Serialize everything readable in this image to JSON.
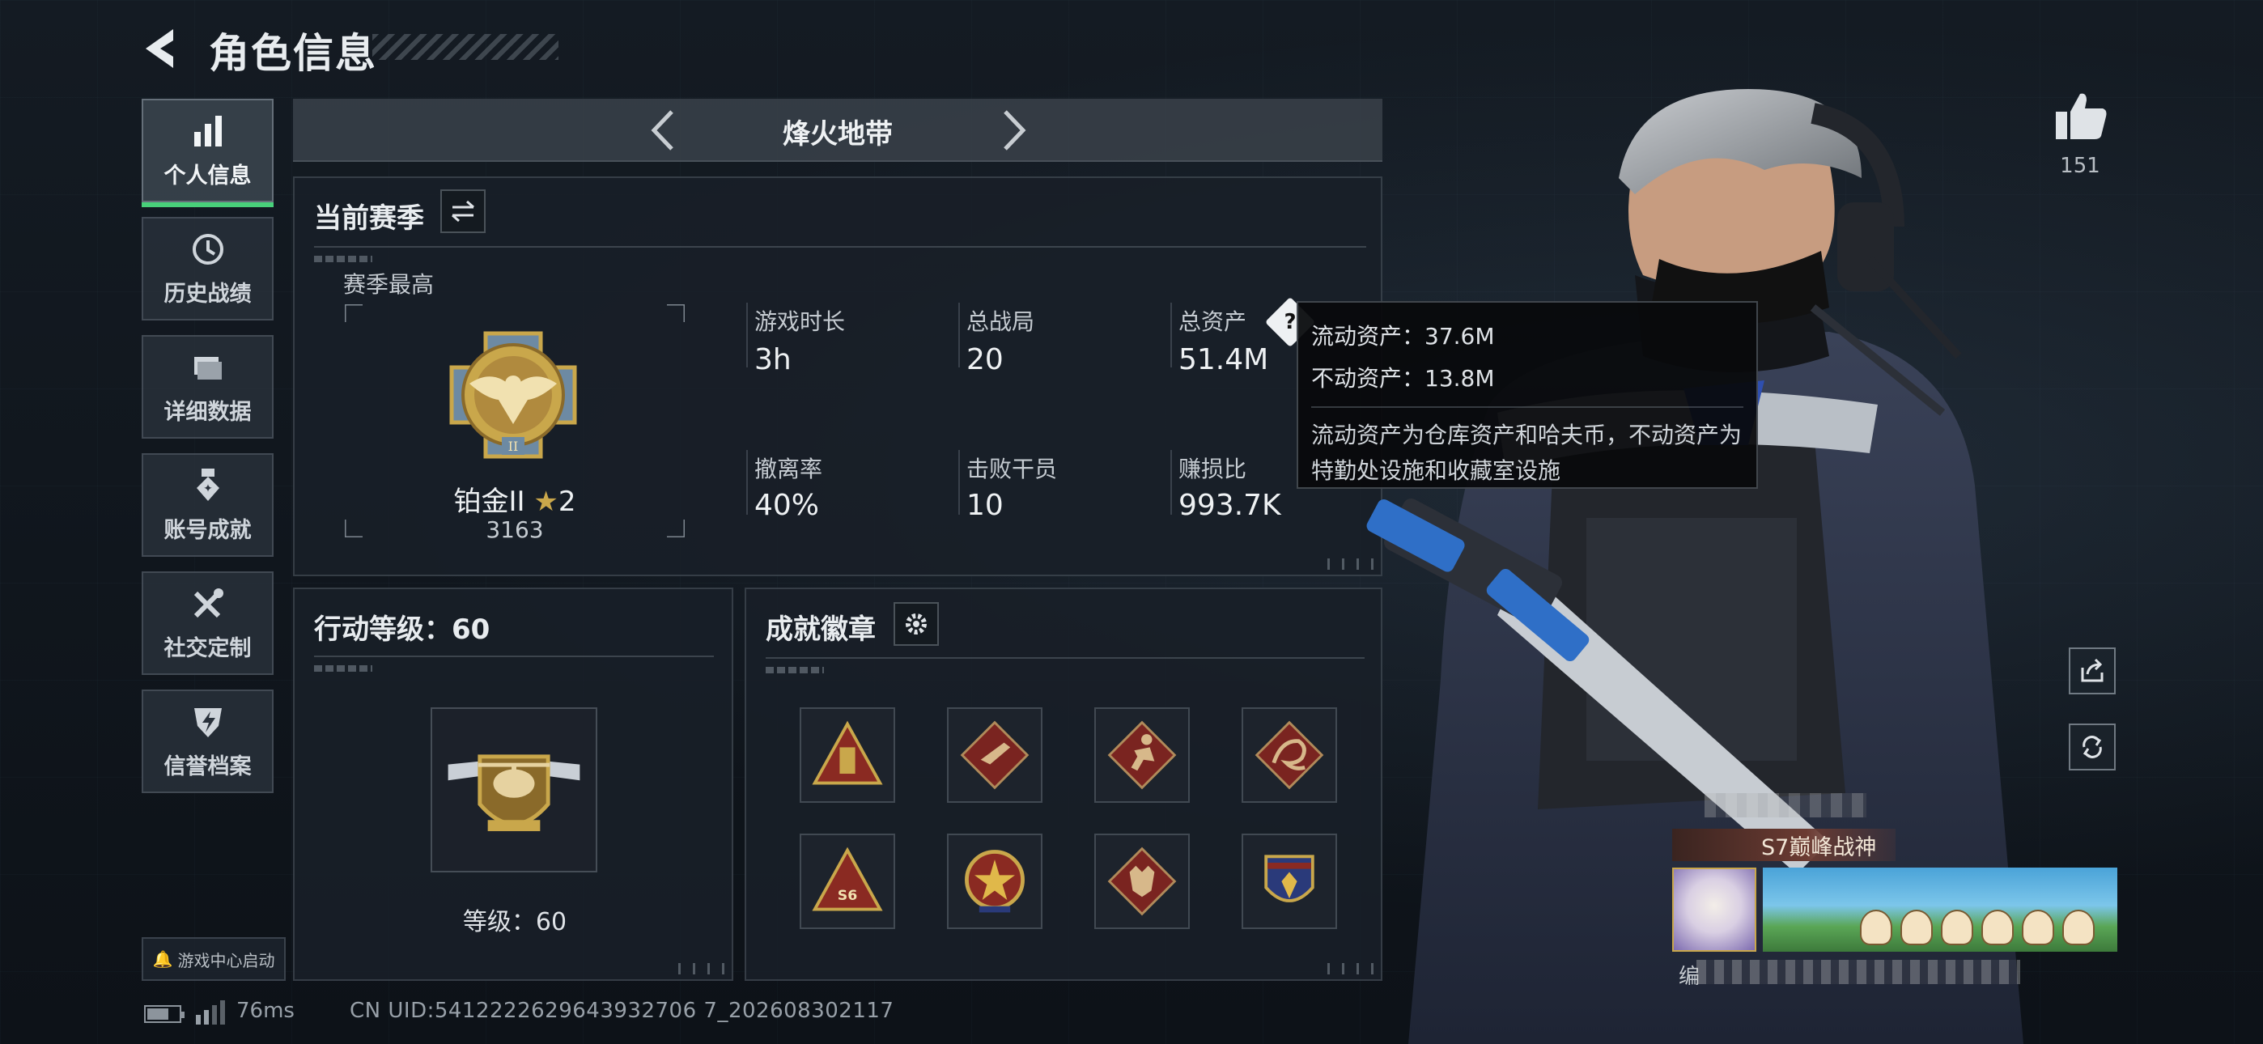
{
  "header": {
    "title": "角色信息"
  },
  "sidebar": {
    "items": [
      {
        "label": "个人信息",
        "icon": "bar-chart-icon",
        "active": true
      },
      {
        "label": "历史战绩",
        "icon": "history-clock-icon",
        "active": false
      },
      {
        "label": "详细数据",
        "icon": "folder-icon",
        "active": false
      },
      {
        "label": "账号成就",
        "icon": "medal-icon",
        "active": false
      },
      {
        "label": "社交定制",
        "icon": "tools-icon",
        "active": false
      },
      {
        "label": "信誉档案",
        "icon": "shield-badge-icon",
        "active": false
      }
    ],
    "game_center_label": "游戏中心启动"
  },
  "mode": {
    "title": "烽火地带"
  },
  "season": {
    "title": "当前赛季",
    "best_label": "赛季最高",
    "rank_name": "铂金II",
    "rank_stars": "2",
    "rank_points": "3163",
    "stats": [
      {
        "label": "游戏时长",
        "value": "3h"
      },
      {
        "label": "总战局",
        "value": "20"
      },
      {
        "label": "总资产",
        "value": "51.4M"
      },
      {
        "label": "撤离率",
        "value": "40%"
      },
      {
        "label": "击败干员",
        "value": "10"
      },
      {
        "label": "赚损比",
        "value": "993.7K"
      }
    ],
    "help_badge": "?"
  },
  "tooltip": {
    "liquid": "流动资产：37.6M",
    "fixed": "不动资产：13.8M",
    "description": "流动资产为仓库资产和哈夫币，不动资产为特勤处设施和收藏室设施"
  },
  "action_level": {
    "title": "行动等级：60",
    "level_label": "等级：60"
  },
  "achievements": {
    "title": "成就徽章",
    "badges": [
      {
        "icon": "ammo-triangle-badge-icon",
        "color": "#8a2a22"
      },
      {
        "icon": "pistol-diamond-badge-icon",
        "color": "#7a2420"
      },
      {
        "icon": "runner-diamond-badge-icon",
        "color": "#7a2420"
      },
      {
        "icon": "dragon-diamond-badge-icon",
        "color": "#7a2420"
      },
      {
        "icon": "s6-triangle-badge-icon",
        "color": "#8a2a22"
      },
      {
        "icon": "star-emblem-badge-icon",
        "color": "#8a2a22"
      },
      {
        "icon": "wolf-diamond-badge-icon",
        "color": "#7a2420"
      },
      {
        "icon": "eagle-shield-badge-icon",
        "color": "#2a3a7a"
      }
    ]
  },
  "like": {
    "count": "151"
  },
  "player_card": {
    "title": "S7巅峰战神",
    "uid_prefix": "编"
  },
  "footer": {
    "ping": "76ms",
    "uid": "CN UID:5412222629643932706 7_202608302117"
  },
  "colors": {
    "accent_green": "#48d07a",
    "gold": "#c9a74b"
  }
}
